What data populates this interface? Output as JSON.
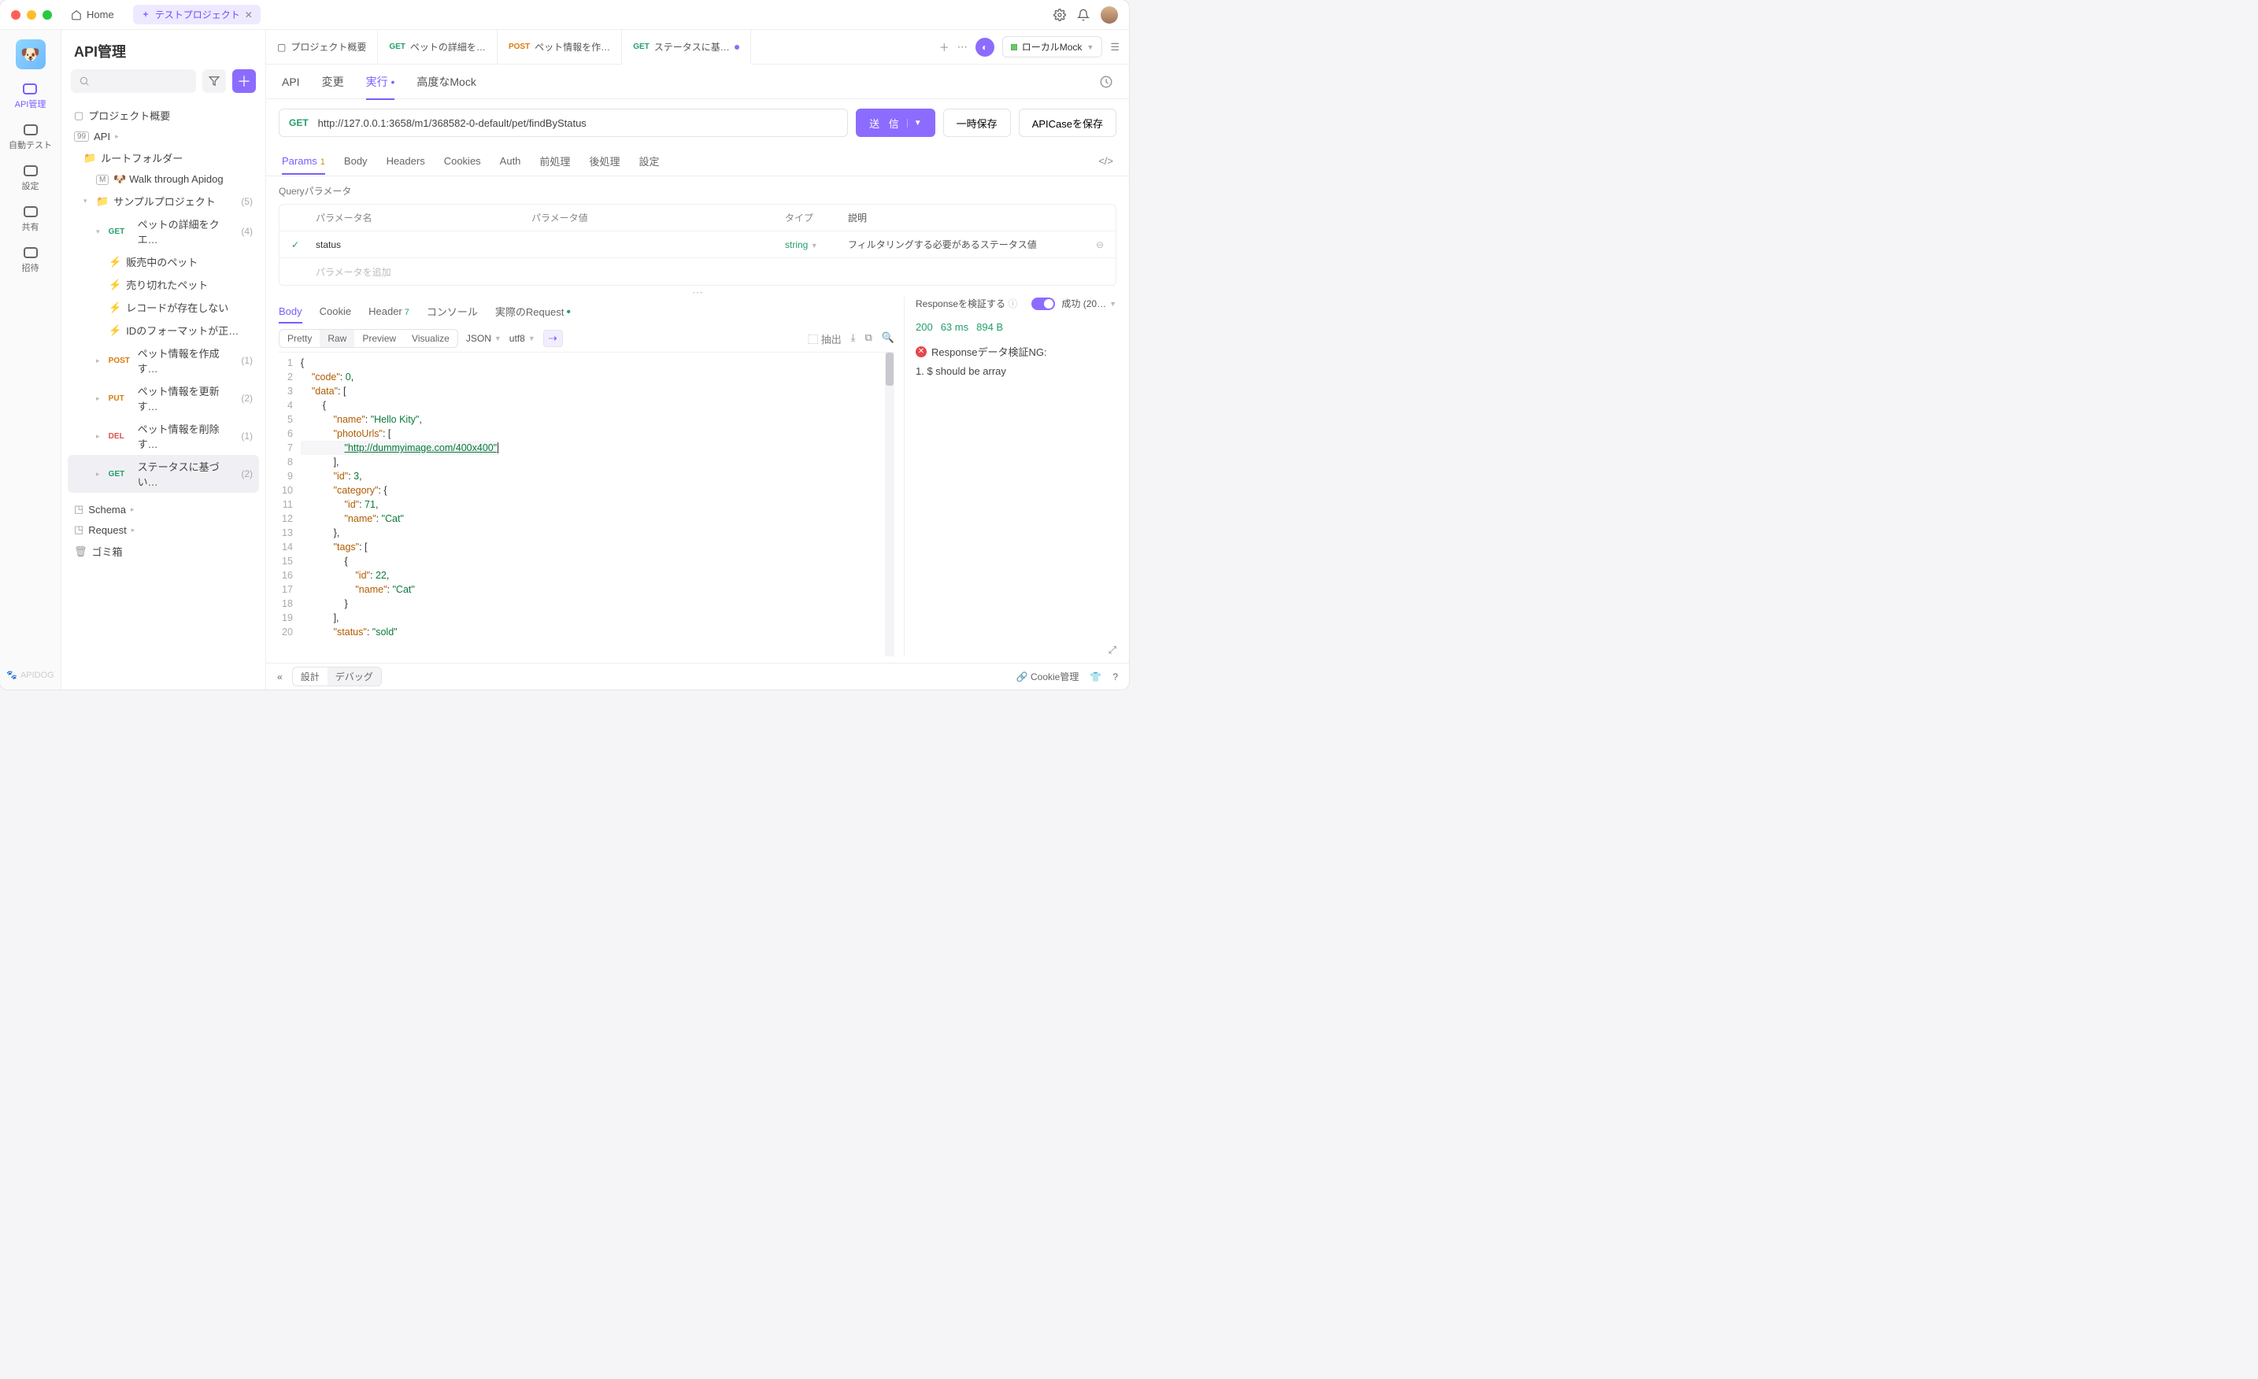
{
  "titlebar": {
    "home": "Home",
    "tab": "テストプロジェクト"
  },
  "rail": {
    "items": [
      "API管理",
      "自動テスト",
      "設定",
      "共有",
      "招待"
    ],
    "brand": "APIDOG"
  },
  "sidebar": {
    "title": "API管理",
    "overview": "プロジェクト概要",
    "api_root": "API",
    "root_folder": "ルートフォルダー",
    "walk": "🐶 Walk through Apidog",
    "sample": "サンプルプロジェクト",
    "sample_cnt": "(5)",
    "items": [
      {
        "meth": "GET",
        "label": "ペットの詳細をクエ…",
        "cnt": "(4)"
      },
      {
        "leaf": true,
        "label": "販売中のペット"
      },
      {
        "leaf": true,
        "label": "売り切れたペット"
      },
      {
        "leaf": true,
        "label": "レコードが存在しない"
      },
      {
        "leaf": true,
        "label": "IDのフォーマットが正…"
      },
      {
        "meth": "POST",
        "label": "ペット情報を作成す…",
        "cnt": "(1)"
      },
      {
        "meth": "PUT",
        "label": "ペット情報を更新す…",
        "cnt": "(2)"
      },
      {
        "meth": "DEL",
        "label": "ペット情報を削除す…",
        "cnt": "(1)"
      },
      {
        "meth": "GET",
        "label": "ステータスに基づい…",
        "cnt": "(2)",
        "sel": true
      }
    ],
    "schema": "Schema",
    "request": "Request",
    "trash": "ゴミ箱"
  },
  "tabs": [
    {
      "icon": "overview",
      "label": "プロジェクト概要"
    },
    {
      "meth": "GET",
      "label": "ペットの詳細を…"
    },
    {
      "meth": "POST",
      "label": "ペット情報を作…"
    },
    {
      "meth": "GET",
      "label": "ステータスに基…",
      "active": true,
      "dirty": true
    }
  ],
  "env": "ローカルMock",
  "subtabs": {
    "api": "API",
    "change": "変更",
    "run": "実行",
    "mock": "高度なMock"
  },
  "url": {
    "method": "GET",
    "value": "http://127.0.0.1:3658/m1/368582-0-default/pet/findByStatus"
  },
  "buttons": {
    "send": "送 信",
    "save": "一時保存",
    "apicase": "APICaseを保存"
  },
  "ptabs": {
    "params": "Params",
    "params_badge": "1",
    "body": "Body",
    "headers": "Headers",
    "cookies": "Cookies",
    "auth": "Auth",
    "pre": "前処理",
    "post": "後処理",
    "settings": "設定"
  },
  "params": {
    "section_label": "Queryパラメータ",
    "head": {
      "name": "パラメータ名",
      "val": "パラメータ値",
      "type": "タイプ",
      "desc": "説明"
    },
    "row": {
      "name": "status",
      "type": "string",
      "desc": "フィルタリングする必要があるステータス値"
    },
    "add_placeholder": "パラメータを追加"
  },
  "rtabs": {
    "body": "Body",
    "cookie": "Cookie",
    "header": "Header",
    "header_badge": "7",
    "console": "コンソール",
    "actual": "実際のRequest"
  },
  "view": {
    "pretty": "Pretty",
    "raw": "Raw",
    "preview": "Preview",
    "visualize": "Visualize",
    "fmt": "JSON",
    "enc": "utf8",
    "extract": "抽出"
  },
  "code": [
    "{",
    "    \"code\": 0,",
    "    \"data\": [",
    "        {",
    "            \"name\": \"Hello Kity\",",
    "            \"photoUrls\": [",
    "                \"http://dummyimage.com/400x400\"",
    "            ],",
    "            \"id\": 3,",
    "            \"category\": {",
    "                \"id\": 71,",
    "                \"name\": \"Cat\"",
    "            },",
    "            \"tags\": [",
    "                {",
    "                    \"id\": 22,",
    "                    \"name\": \"Cat\"",
    "                }",
    "            ],",
    "            \"status\": \"sold\""
  ],
  "resp_right": {
    "validate": "Responseを検証する",
    "success": "成功 (20…",
    "status": "200",
    "time": "63 ms",
    "size": "894 B",
    "err_title": "Responseデータ検証NG:",
    "err_item": "1. $ should be array"
  },
  "footer": {
    "design": "設計",
    "debug": "デバッグ",
    "cookie": "Cookie管理"
  }
}
